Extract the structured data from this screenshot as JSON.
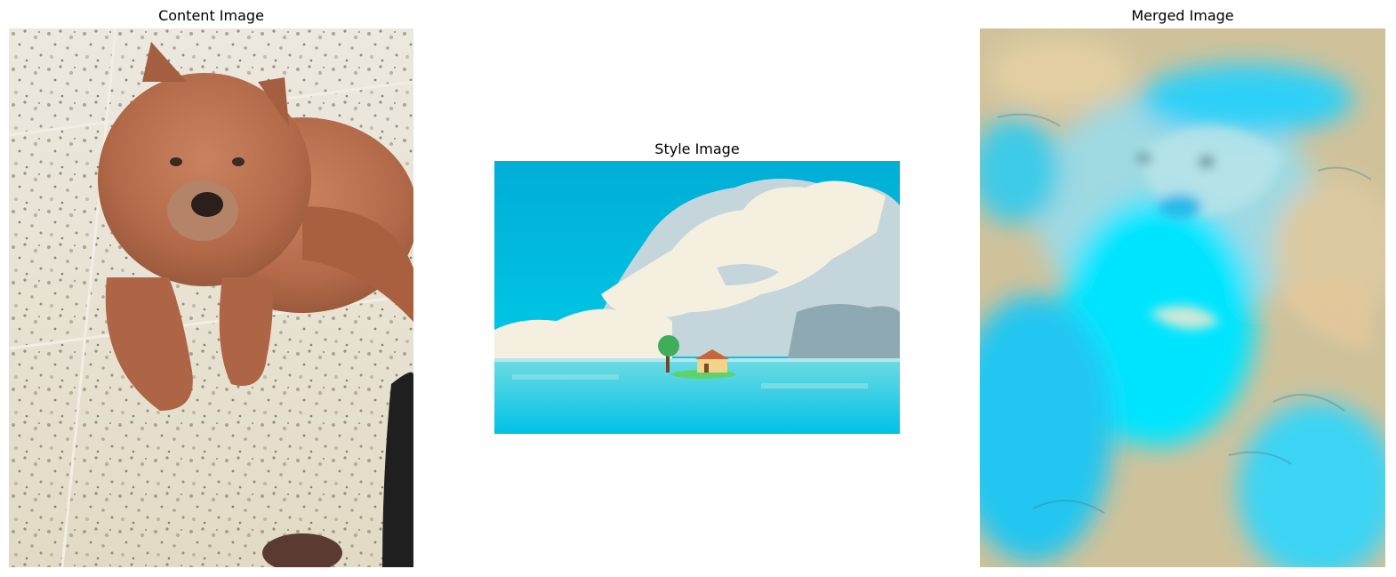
{
  "panels": {
    "content": {
      "title": "Content Image"
    },
    "style": {
      "title": "Style Image"
    },
    "merged": {
      "title": "Merged Image"
    }
  },
  "colors": {
    "floor": "#e3ddd0",
    "dog_fur": "#b9714f",
    "sky": "#00b4d8",
    "cloud": "#f5efe0",
    "cloud_shadow": "#c4d6dc",
    "water": "#4fd2e0",
    "merged_cyan": "#00e5ff",
    "merged_sand": "#d9c59a"
  }
}
